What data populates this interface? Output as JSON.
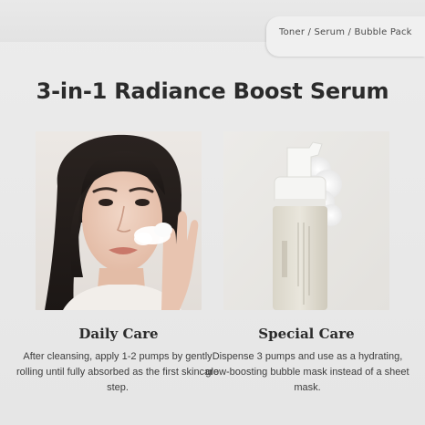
{
  "tag": {
    "text": "Toner / Serum / Bubble Pack"
  },
  "title": "3-in-1 Radiance Boost Serum",
  "cards": [
    {
      "image": "woman-applying-foam-to-cheek",
      "label": "Daily Care",
      "description": "After cleansing, apply 1-2 pumps by gently rolling until fully absorbed as the first skincare step."
    },
    {
      "image": "foam-pump-bottle-with-bubbles",
      "label": "Special Care",
      "description": "Dispense 3 pumps and use as a hydrating, glow-boosting bubble mask instead of a sheet mask."
    }
  ],
  "colors": {
    "background": "#e8e8e8",
    "text": "#2b2b2b",
    "tag_background": "#f0f0f0"
  }
}
